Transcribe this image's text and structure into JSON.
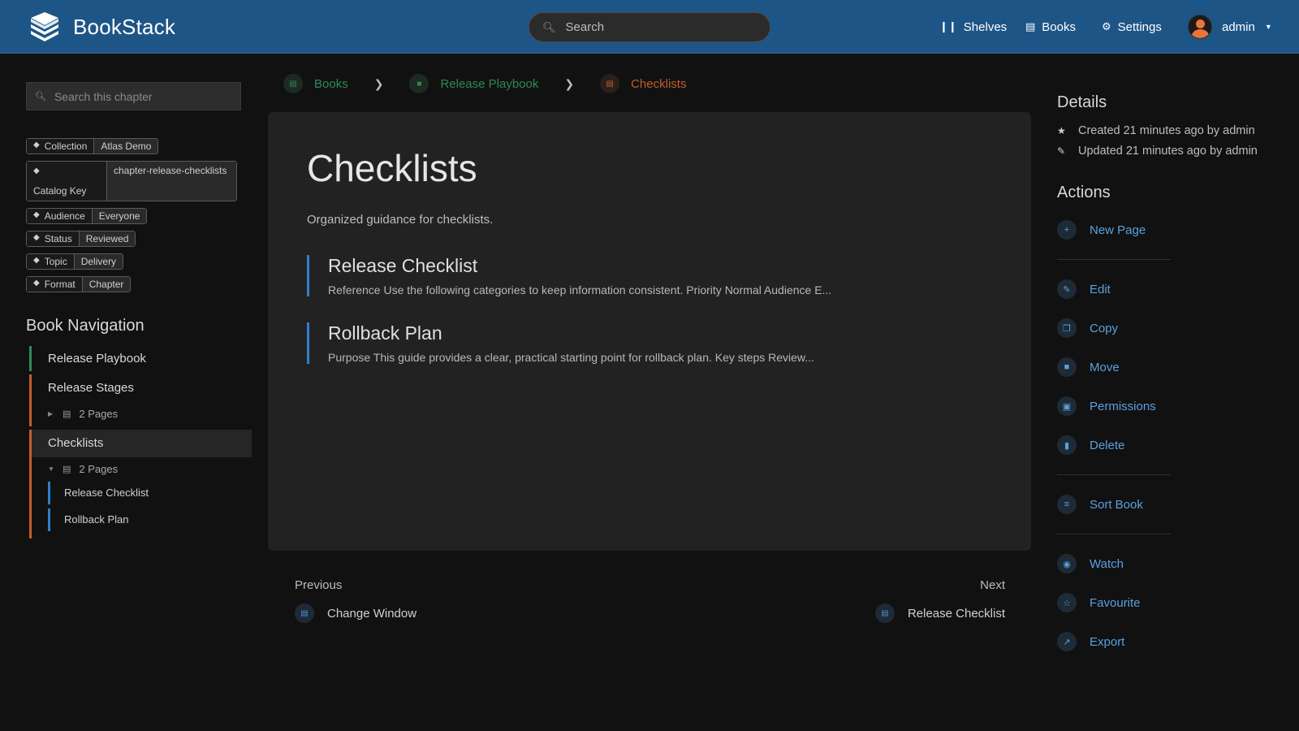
{
  "app": {
    "name": "BookStack",
    "accent": "#1e5587"
  },
  "header": {
    "search_placeholder": "Search",
    "nav": [
      {
        "label": "Shelves",
        "icon": "shelves-icon"
      },
      {
        "label": "Books",
        "icon": "books-icon"
      },
      {
        "label": "Settings",
        "icon": "settings-icon"
      }
    ],
    "user": {
      "name": "admin"
    }
  },
  "sidebar": {
    "search_placeholder": "Search this chapter",
    "tags": [
      {
        "name": "Collection",
        "value": "Atlas Demo"
      },
      {
        "name": "Catalog Key",
        "value": "chapter-release-checklists"
      },
      {
        "name": "Audience",
        "value": "Everyone"
      },
      {
        "name": "Status",
        "value": "Reviewed"
      },
      {
        "name": "Topic",
        "value": "Delivery"
      },
      {
        "name": "Format",
        "value": "Chapter"
      }
    ],
    "book_nav_title": "Book Navigation",
    "book": "Release Playbook",
    "chapters": [
      {
        "title": "Release Stages",
        "pages_label": "2 Pages"
      },
      {
        "title": "Checklists",
        "pages_label": "2 Pages",
        "pages": [
          "Release Checklist",
          "Rollback Plan"
        ]
      }
    ]
  },
  "breadcrumb": [
    {
      "label": "Books",
      "color": "#2f8a57"
    },
    {
      "label": "Release Playbook",
      "color": "#2f8a57"
    },
    {
      "label": "Checklists",
      "color": "#c55d2a"
    }
  ],
  "main": {
    "title": "Checklists",
    "description": "Organized guidance for checklists.",
    "pages": [
      {
        "title": "Release Checklist",
        "excerpt": "Reference Use the following categories to keep information consistent. Priority Normal Audience E..."
      },
      {
        "title": "Rollback Plan",
        "excerpt": "Purpose This guide provides a clear, practical starting point for rollback plan. Key steps Review..."
      }
    ]
  },
  "prevnext": {
    "previous_label": "Previous",
    "previous_page": "Change Window",
    "next_label": "Next",
    "next_page": "Release Checklist"
  },
  "details": {
    "title": "Details",
    "created": "Created 21 minutes ago by admin",
    "updated": "Updated 21 minutes ago by admin"
  },
  "actions": {
    "title": "Actions",
    "new_page": "New Page",
    "edit": "Edit",
    "copy": "Copy",
    "move": "Move",
    "permissions": "Permissions",
    "delete": "Delete",
    "sort_book": "Sort Book",
    "watch": "Watch",
    "favourite": "Favourite",
    "export": "Export"
  }
}
